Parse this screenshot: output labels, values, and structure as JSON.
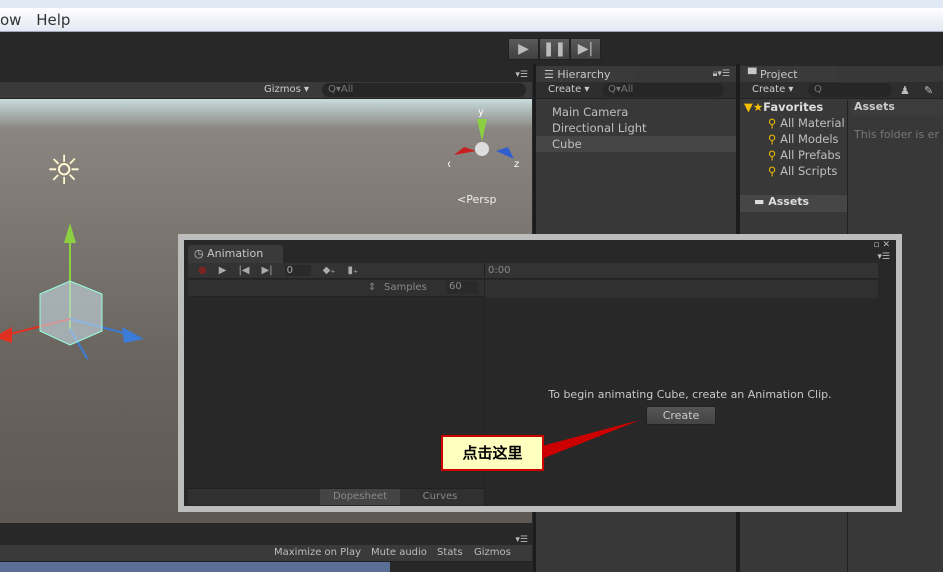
{
  "menu": {
    "items": [
      "ow",
      "Help"
    ]
  },
  "toolbar": {
    "play_icons": [
      "play-icon",
      "pause-icon",
      "step-icon"
    ]
  },
  "scene": {
    "gizmos_label": "Gizmos",
    "search_placeholder": "All",
    "persp_label": "Persp",
    "axis_labels": {
      "x": "x",
      "y": "y",
      "z": "z"
    }
  },
  "hierarchy": {
    "title": "Hierarchy",
    "create_label": "Create",
    "search_placeholder": "All",
    "items": [
      "Main Camera",
      "Directional Light",
      "Cube"
    ],
    "selected": "Cube"
  },
  "project": {
    "title": "Project",
    "create_label": "Create",
    "favorites_label": "Favorites",
    "favorites": [
      "All Material",
      "All Models",
      "All Prefabs",
      "All Scripts"
    ],
    "assets_label": "Assets",
    "assets_header": "Assets",
    "empty_text": "This folder is er"
  },
  "animation": {
    "title": "Animation",
    "frame_value": "0",
    "time_label": "0:00",
    "samples_label": "Samples",
    "samples_value": "60",
    "message": "To begin animating Cube, create an Animation Clip.",
    "create_button": "Create",
    "tabs": [
      "Dopesheet",
      "Curves"
    ]
  },
  "game": {
    "buttons": [
      "Maximize on Play",
      "Mute audio",
      "Stats",
      "Gizmos"
    ]
  },
  "callout": {
    "text": "点击这里",
    "border_color": "#cc0000",
    "fill_color": "#ffffc0"
  }
}
